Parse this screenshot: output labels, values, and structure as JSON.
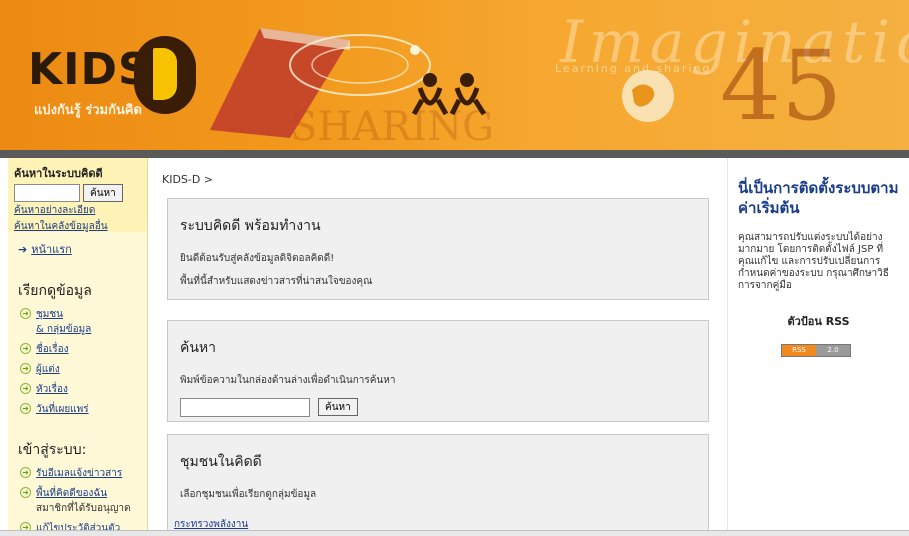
{
  "banner": {
    "logo_text": "KIDS",
    "tagline": "แบ่งกันรู้ ร่วมกันคิด",
    "deco_word": "Imagination",
    "deco_small": "Learning and sharing",
    "deco_share": "SHARING",
    "deco_numbers": "45"
  },
  "sidebar": {
    "search_title": "ค้นหาในระบบคิดดี",
    "search_button": "ค้นหา",
    "advanced_search": "ค้นหาอย่างละเอียด",
    "search_other": "ค้นหาในคลังข้อมูลอื่น",
    "home": "หน้าแรก",
    "browse_heading": "เรียกดูข้อมูล",
    "browse_items": [
      {
        "label": "ชุมชน",
        "sub": "& กลุ่มข้อมูล"
      },
      {
        "label": "ชื่อเรื่อง"
      },
      {
        "label": "ผู้แต่ง"
      },
      {
        "label": "หัวเรื่อง"
      },
      {
        "label": "วันที่เผยแพร่"
      }
    ],
    "login_heading": "เข้าสู่ระบบ:",
    "login_items": [
      {
        "label": "รับอีเมลแจ้งข่าวสาร"
      },
      {
        "label": "พื้นที่คิดดีของฉัน",
        "sub": "สมาชิกที่ได้รับอนุญาต"
      },
      {
        "label": "แก้ไขประวัติส่วนตัว"
      }
    ]
  },
  "main": {
    "breadcrumb": "KIDS-D >",
    "box1": {
      "title": "ระบบคิดดี พร้อมทำงาน",
      "line1": "ยินดีต้อนรับสู่คลังข้อมูลดิจิตอลคิดดี!",
      "line2": "พื้นที่นี้สำหรับแสดงข่าวสารที่น่าสนใจของคุณ"
    },
    "box2": {
      "title": "ค้นหา",
      "desc": "พิมพ์ข้อความในกล่องด้านล่างเพื่อดำเนินการค้นหา",
      "button": "ค้นหา"
    },
    "box3": {
      "title": "ชุมชนในคิดดี",
      "desc": "เลือกชุมชนเพื่อเรียกดูกลุ่มข้อมูล",
      "link": "กระทรวงพลังงาน"
    }
  },
  "rightbar": {
    "title": "นี่เป็นการติดตั้งระบบตามค่าเริ่มต้น",
    "text": "คุณสามารถปรับแต่งระบบได้อย่างมากมาย โดยการติดตั้งไฟล์ JSP ที่คุณแก้ไข และการปรับเปลี่ยนการกำหนดค่าของระบบ กรุณาศึกษาวิธีการจากคู่มือ",
    "rss_label": "ตัวป้อน RSS",
    "rss_left": "RSS",
    "rss_right": "2.0"
  }
}
